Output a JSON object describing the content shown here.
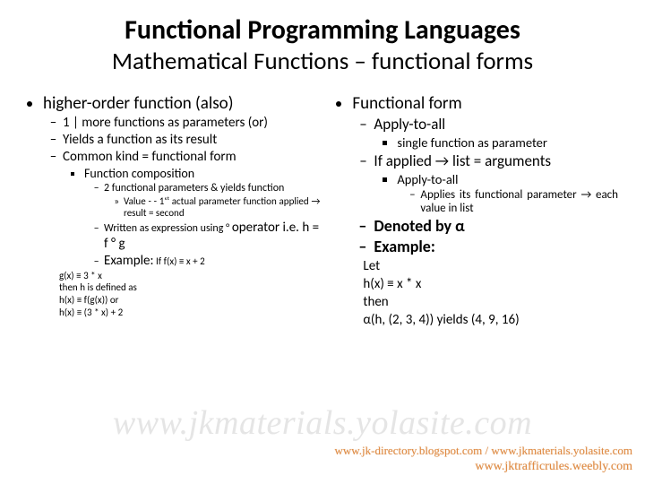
{
  "title": "Functional Programming Languages",
  "subtitle": "Mathematical Functions – functional forms",
  "left": {
    "b1": "higher-order function (also)",
    "b1a": "1 | more functions as parameters (or)",
    "b1b": "Yields a function as its result",
    "b1c": "Common kind = functional form",
    "fc": "Function composition",
    "fc1": "2 functional parameters & yields function",
    "fc1v": "Value - - 1ˢᵗ actual parameter function applied → result = second",
    "fc2": "Written as expression using ° ",
    "fc2b": "operator i.e. h = f ° g",
    "ex": "Example:",
    "exa": " If f(x) ≡ x + 2",
    "m1": "g(x) ≡ 3 * x",
    "m2": "then h is defined as",
    "m3": "h(x) ≡  f(g(x)) or",
    "m4": "h(x) ≡ (3 * x) + 2"
  },
  "right": {
    "b1": "Functional form",
    "a1": "Apply-to-all",
    "a1s": "single function as parameter",
    "a2": "If applied → list = arguments",
    "a2a": "Apply-to-all",
    "a2a1": "Applies its functional parameter → each value in list",
    "d1": "Denoted by α",
    "d2": "Example:",
    "e1": "Let",
    "e2": "h(x) ≡ x * x",
    "e3": "then",
    "e4": "α(h, (2, 3, 4)) yields (4, 9, 16)"
  },
  "watermark": "www.jkmaterials.yolasite.com",
  "footer1": "www.jk-directory.blogspot.com / www.jkmaterials.yolasite.com",
  "footer2": "www.jktrafficrules.weebly.com"
}
